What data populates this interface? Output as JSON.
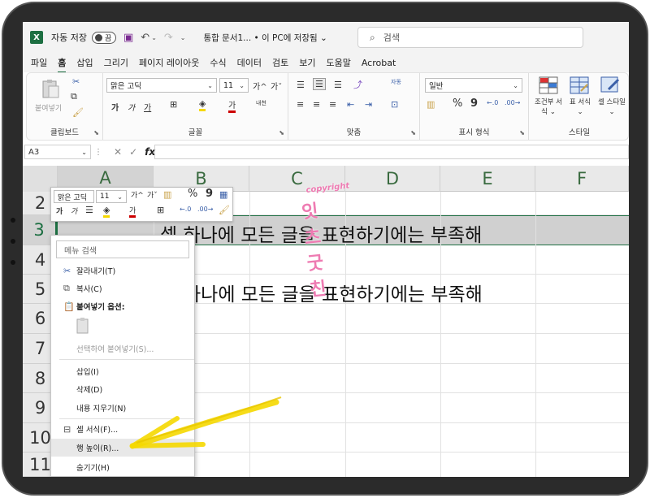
{
  "titlebar": {
    "app_icon": "X",
    "autosave_label": "자동 저장",
    "toggle_label": "끔",
    "doc_title": "통합 문서1... • 이 PC에 저장됨 ⌄",
    "search_placeholder": "검색"
  },
  "tabs": [
    "파일",
    "홈",
    "삽입",
    "그리기",
    "페이지 레이아웃",
    "수식",
    "데이터",
    "검토",
    "보기",
    "도움말",
    "Acrobat"
  ],
  "ribbon": {
    "paste_label": "붙여넣기",
    "clipboard_label": "클립보드",
    "font_name": "맑은 고딕",
    "font_size": "11",
    "font_group_label": "글꼴",
    "bold": "가",
    "italic": "가",
    "underline": "가",
    "ruby": "내천",
    "grow_font": "가^",
    "shrink_font": "가ˇ",
    "align_label": "맞춤",
    "wrap_label": "자동",
    "number_format": "일반",
    "number_group_label": "표시 형식",
    "percent": "%",
    "comma": "9",
    "cond_format_label": "조건부 서식 ⌄",
    "table_format_label": "표 서식 ⌄",
    "cell_style_label": "셀 스타일 ⌄",
    "style_group_label": "스타일"
  },
  "formula_bar": {
    "name_box": "A3",
    "fx": "fx",
    "value": ""
  },
  "grid": {
    "columns": [
      "A",
      "B",
      "C",
      "D",
      "E",
      "F"
    ],
    "rows": [
      "2",
      "3",
      "4",
      "5",
      "6",
      "7",
      "8",
      "9",
      "10",
      "11"
    ],
    "cell_b3": "셀 하나에 모든 글을 표현하기에는 부족해",
    "cell_b5": "하나에 모든 글을 표현하기에는 부족해"
  },
  "mini_toolbar": {
    "font_name": "맑은 고딕",
    "font_size": "11",
    "percent": "%",
    "comma": "9"
  },
  "context_menu": {
    "search_placeholder": "메뉴 검색",
    "items": [
      {
        "label": "잘라내기(T)",
        "icon": "scissors-icon"
      },
      {
        "label": "복사(C)",
        "icon": "copy-icon"
      },
      {
        "label": "붙여넣기 옵션:",
        "icon": "paste-icon"
      },
      {
        "label": "선택하여 붙여넣기(S)...",
        "icon": ""
      },
      {
        "label": "삽입(I)",
        "icon": ""
      },
      {
        "label": "삭제(D)",
        "icon": ""
      },
      {
        "label": "내용 지우기(N)",
        "icon": ""
      },
      {
        "label": "셀 서식(F)...",
        "icon": "format-cells-icon"
      },
      {
        "label": "행 높이(R)...",
        "icon": ""
      },
      {
        "label": "숨기기(H)",
        "icon": ""
      }
    ]
  },
  "watermark": {
    "line1": "copyright",
    "line2": "잇츠굿친"
  },
  "colors": {
    "excel_green": "#1d6f42",
    "highlight_arrow": "#f5d800",
    "watermark_pink": "#ee7bb2"
  }
}
